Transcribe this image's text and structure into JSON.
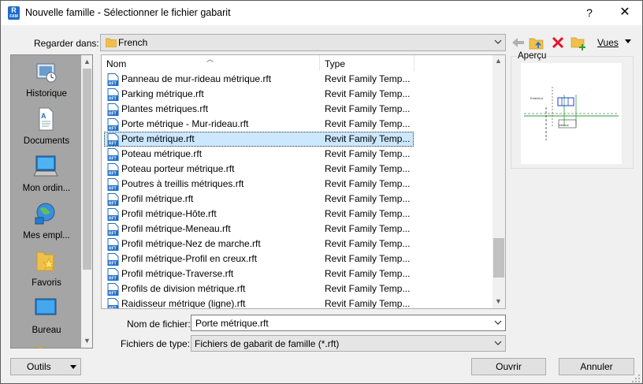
{
  "window": {
    "title": "Nouvelle famille - Sélectionner le fichier gabarit",
    "app_icon_text": "R",
    "app_icon_sub": "FAM",
    "help_label": "?",
    "close_label": "✕"
  },
  "lookin": {
    "label": "Regarder dans:",
    "value": "French"
  },
  "toolbar": {
    "back_icon": "back-arrow-icon",
    "up_icon": "folder-up-icon",
    "delete_icon": "delete-icon",
    "new_folder_icon": "new-folder-icon",
    "views_label": "Vues"
  },
  "places": [
    {
      "label": "Historique",
      "icon": "history-icon"
    },
    {
      "label": "Documents",
      "icon": "documents-icon"
    },
    {
      "label": "Mon ordin...",
      "icon": "computer-icon"
    },
    {
      "label": "Mes empl...",
      "icon": "network-places-icon"
    },
    {
      "label": "Favoris",
      "icon": "favorites-icon"
    },
    {
      "label": "Bureau",
      "icon": "desktop-icon"
    }
  ],
  "filelist": {
    "columns": {
      "name": "Nom",
      "type": "Type"
    },
    "selected_index": 4,
    "rows": [
      {
        "name": "Panneau de mur-rideau métrique.rft",
        "type": "Revit Family Temp..."
      },
      {
        "name": "Parking métrique.rft",
        "type": "Revit Family Temp..."
      },
      {
        "name": "Plantes métriques.rft",
        "type": "Revit Family Temp..."
      },
      {
        "name": "Porte métrique - Mur-rideau.rft",
        "type": "Revit Family Temp..."
      },
      {
        "name": "Porte métrique.rft",
        "type": "Revit Family Temp..."
      },
      {
        "name": "Poteau métrique.rft",
        "type": "Revit Family Temp..."
      },
      {
        "name": "Poteau porteur métrique.rft",
        "type": "Revit Family Temp..."
      },
      {
        "name": "Poutres à treillis métriques.rft",
        "type": "Revit Family Temp..."
      },
      {
        "name": "Profil métrique.rft",
        "type": "Revit Family Temp..."
      },
      {
        "name": "Profil métrique-Hôte.rft",
        "type": "Revit Family Temp..."
      },
      {
        "name": "Profil métrique-Meneau.rft",
        "type": "Revit Family Temp..."
      },
      {
        "name": "Profil métrique-Nez de marche.rft",
        "type": "Revit Family Temp..."
      },
      {
        "name": "Profil métrique-Profil en creux.rft",
        "type": "Revit Family Temp..."
      },
      {
        "name": "Profil métrique-Traverse.rft",
        "type": "Revit Family Temp..."
      },
      {
        "name": "Profils de division métrique.rft",
        "type": "Revit Family Temp..."
      },
      {
        "name": "Raidisseur métrique (ligne).rft",
        "type": "Revit Family Temp..."
      }
    ],
    "file_icon_text": "RFT"
  },
  "preview": {
    "label": "Aperçu",
    "image_text_left": "Extérieur",
    "image_text_bottom": "Intérieur"
  },
  "filename": {
    "label": "Nom de fichier:",
    "value": "Porte métrique.rft"
  },
  "filetype": {
    "label": "Fichiers de type:",
    "value": "Fichiers de gabarit de famille  (*.rft)"
  },
  "buttons": {
    "tools": "Outils",
    "open": "Ouvrir",
    "cancel": "Annuler"
  },
  "colors": {
    "accent": "#1e6cc8",
    "selection": "#cce8ff",
    "places_bg": "#a5a5a5",
    "delete_red": "#e81123",
    "folder_yellow": "#f0c04a"
  }
}
